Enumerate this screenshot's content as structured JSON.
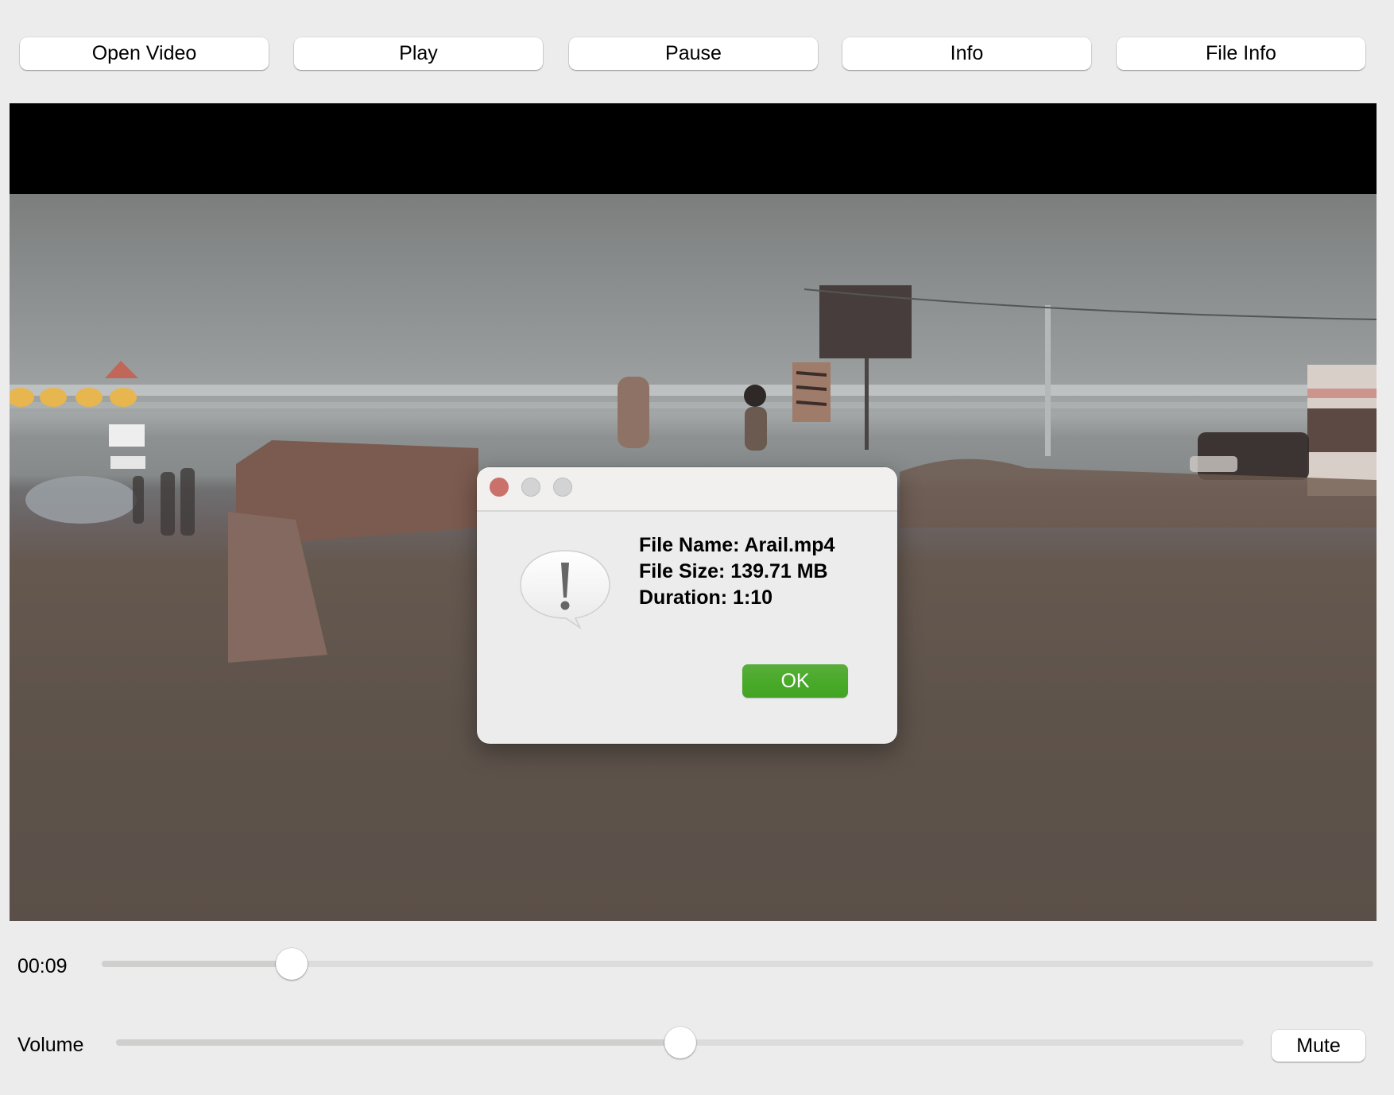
{
  "toolbar": {
    "buttons": [
      {
        "id": "open-video",
        "label": "Open Video"
      },
      {
        "id": "play",
        "label": "Play"
      },
      {
        "id": "pause",
        "label": "Pause"
      },
      {
        "id": "info",
        "label": "Info"
      },
      {
        "id": "file-info",
        "label": "File Info"
      }
    ]
  },
  "video": {
    "description": "Blurry evening beach scene: overcast sky, sea with light reflections, billboard, signboards, people, parked car, sandy ground"
  },
  "dialog": {
    "icon": "alert-speech-bubble-icon",
    "window_controls": [
      "close",
      "minimize",
      "zoom"
    ],
    "lines": [
      "File Name: Arail.mp4",
      "File Size: 139.71 MB",
      "Duration: 1:10"
    ],
    "ok_label": "OK",
    "ok_color": "#4aaa2a"
  },
  "seek": {
    "time_label": "00:09",
    "position_seconds": 9,
    "duration_seconds": 70
  },
  "volume": {
    "label": "Volume",
    "level_percent": 50,
    "mute_label": "Mute"
  },
  "colors": {
    "window_bg": "#ececec",
    "close_light": "#c9716a",
    "track_fill": "#cfcfcd",
    "track_empty": "#dcdcdc"
  }
}
